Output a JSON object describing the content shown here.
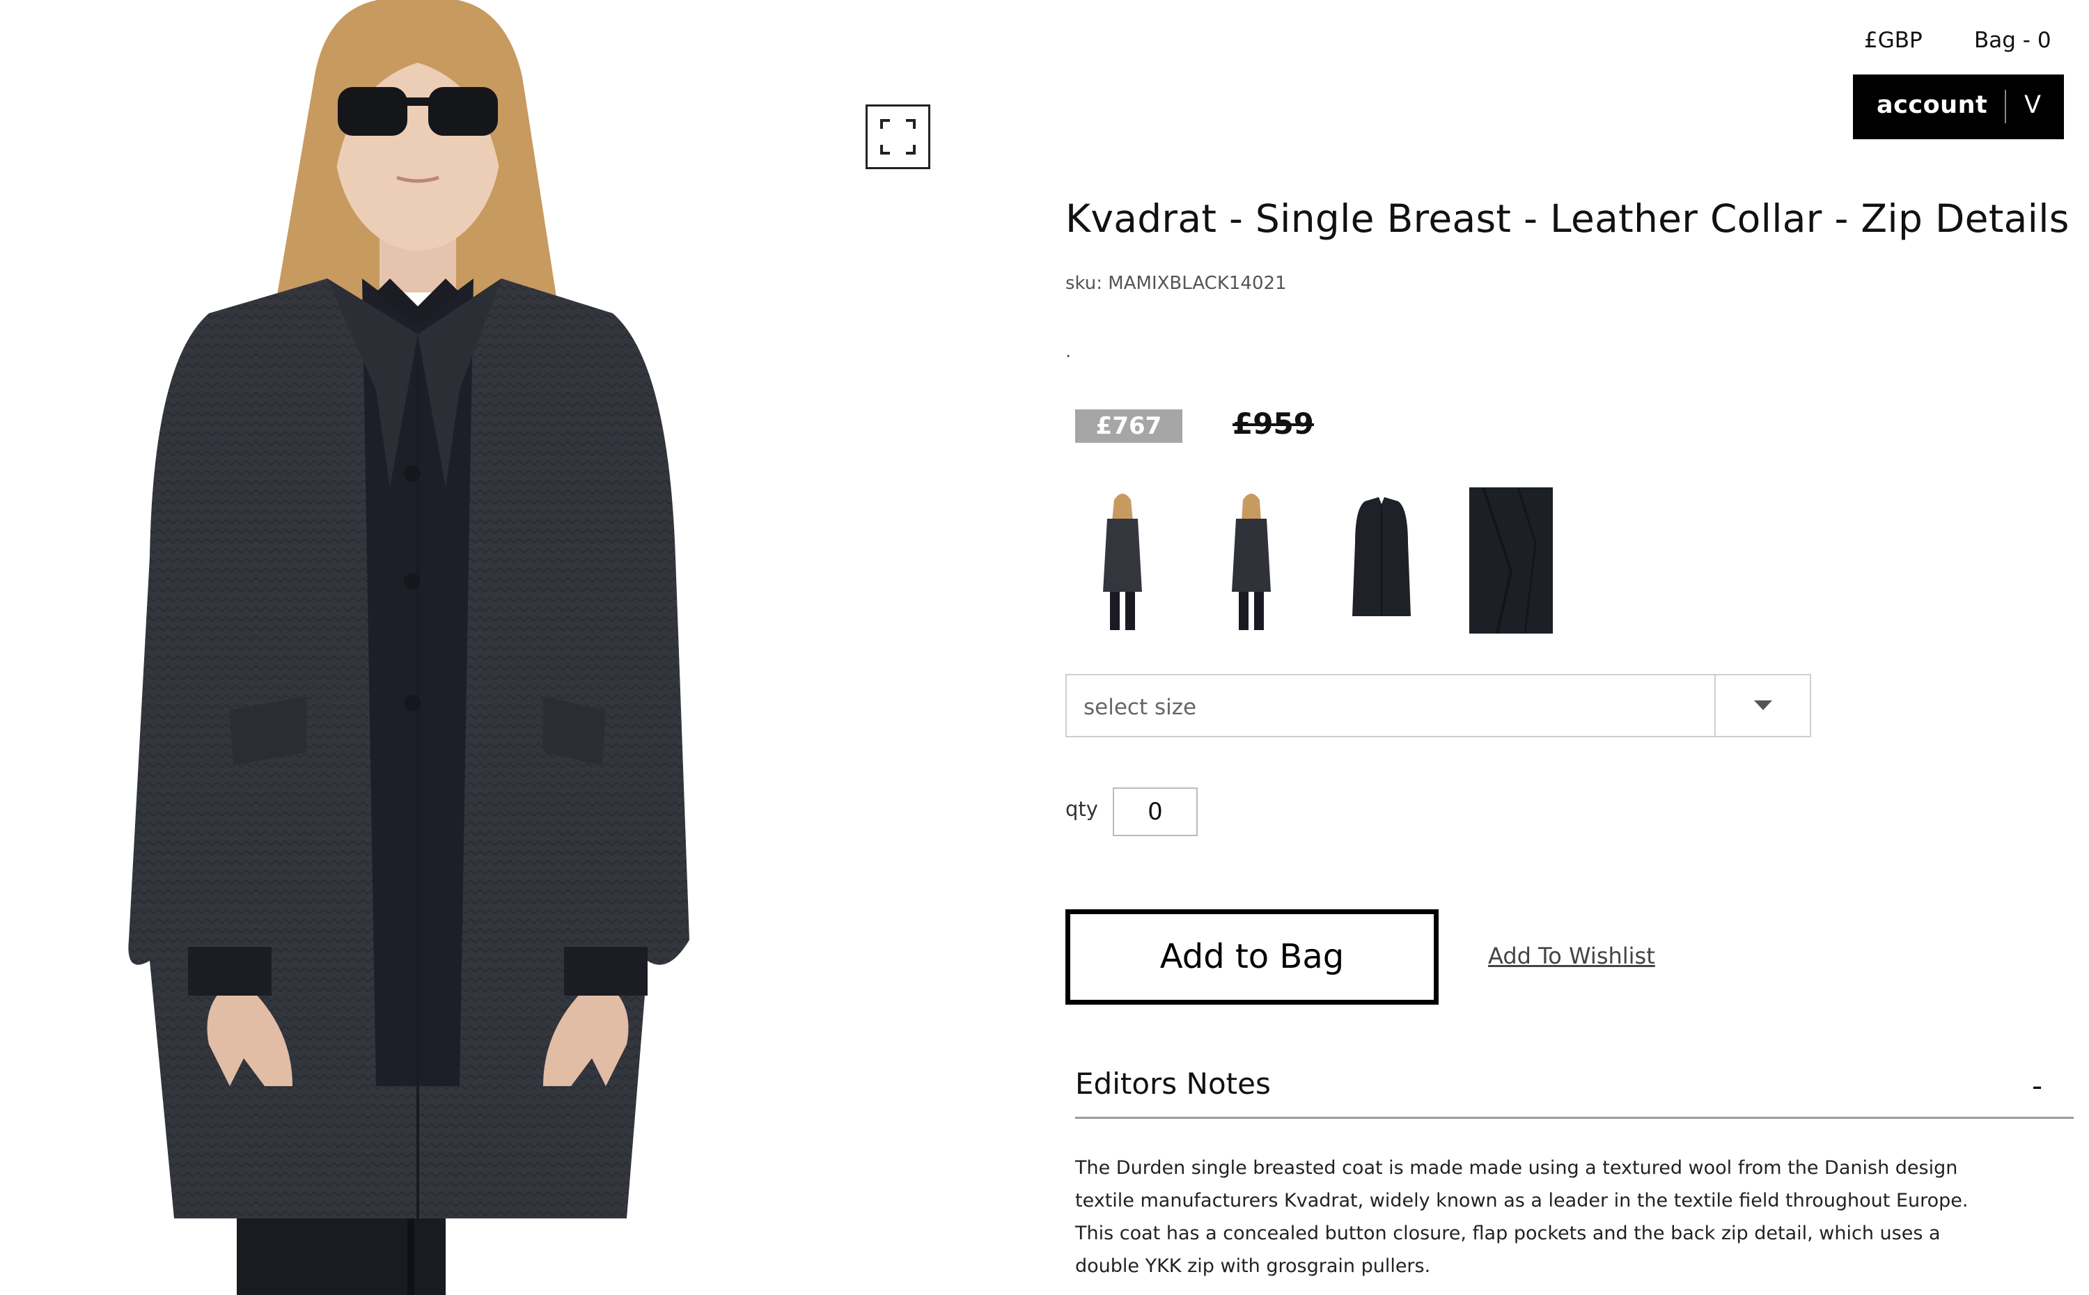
{
  "header": {
    "currency": "£GBP",
    "bag": "Bag - 0",
    "account_label": "account",
    "account_toggle": "V"
  },
  "product": {
    "title": "Kvadrat - Single Breast - Leather Collar - Zip Details",
    "sku": "sku: MAMIXBLACK14021",
    "dot": ".",
    "sale_price": "£767",
    "original_price": "£959"
  },
  "size_select": {
    "placeholder": "select size"
  },
  "qty": {
    "label": "qty",
    "value": "0"
  },
  "actions": {
    "add_to_bag": "Add to Bag",
    "add_to_wishlist": "Add To Wishlist"
  },
  "editors_notes": {
    "title": "Editors Notes",
    "toggle": "-",
    "body": "The Durden single breasted coat is made made using a textured wool from the Danish design textile manufacturers Kvadrat, widely known as a leader in the textile field throughout Europe. This coat has a concealed button closure, flap pockets and the back zip detail, which uses a double YKK zip with grosgrain pullers."
  },
  "colors": {
    "coat": "#33353d",
    "hair": "#c79a5f",
    "price_badge": "#a6a6a6"
  }
}
